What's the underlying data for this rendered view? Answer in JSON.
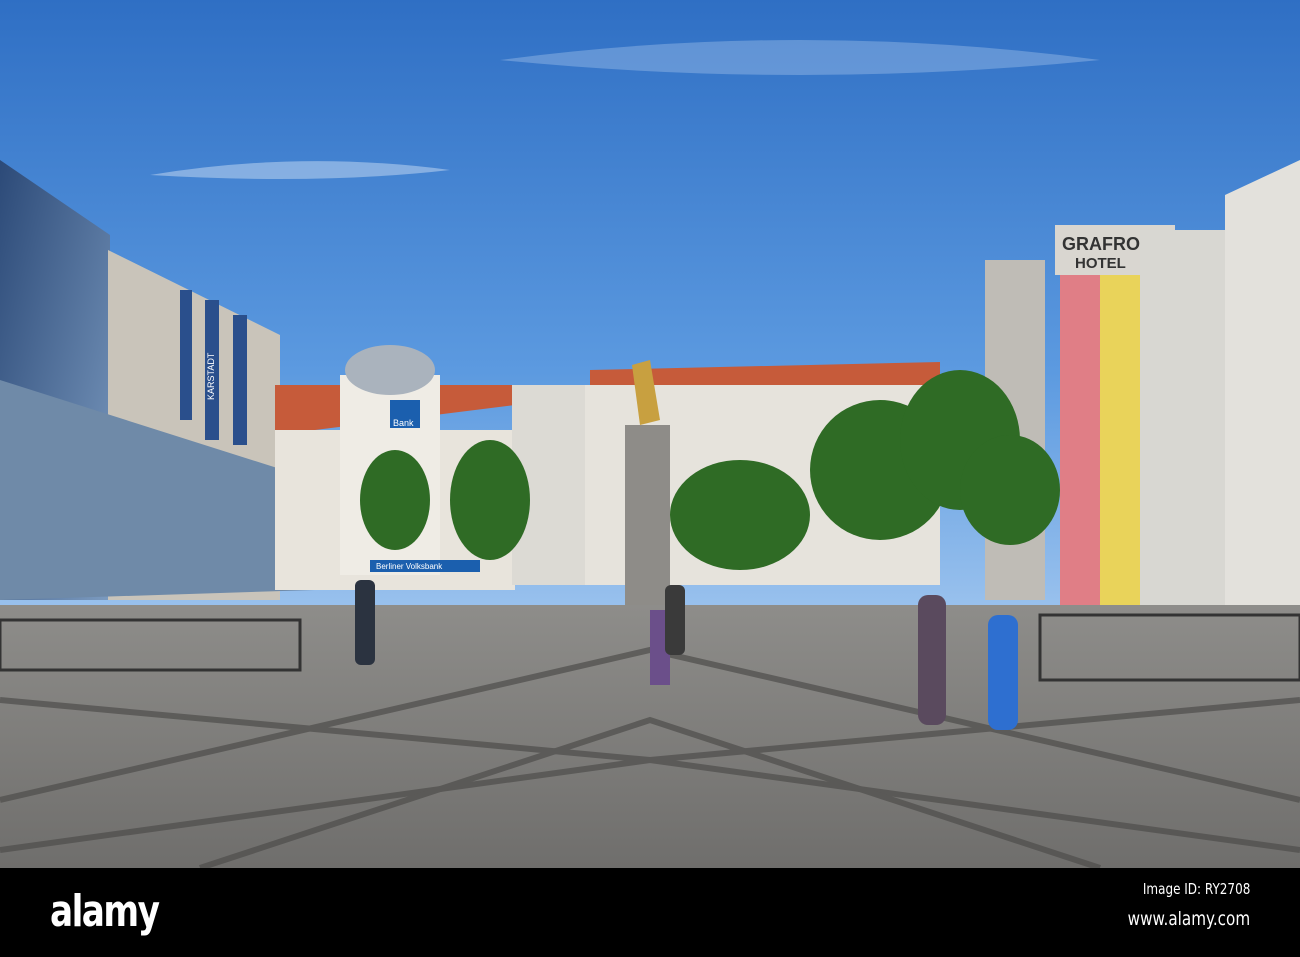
{
  "photo": {
    "signs": {
      "store": "KARSTADT",
      "bank": "Bank",
      "bank_name": "Berliner Volksbank",
      "hotel_top": "GRAFRO",
      "hotel_bottom": "HOTEL"
    }
  },
  "footer": {
    "logo": "alamy",
    "image_id": "Image ID: RY2708",
    "url": "www.alamy.com"
  }
}
